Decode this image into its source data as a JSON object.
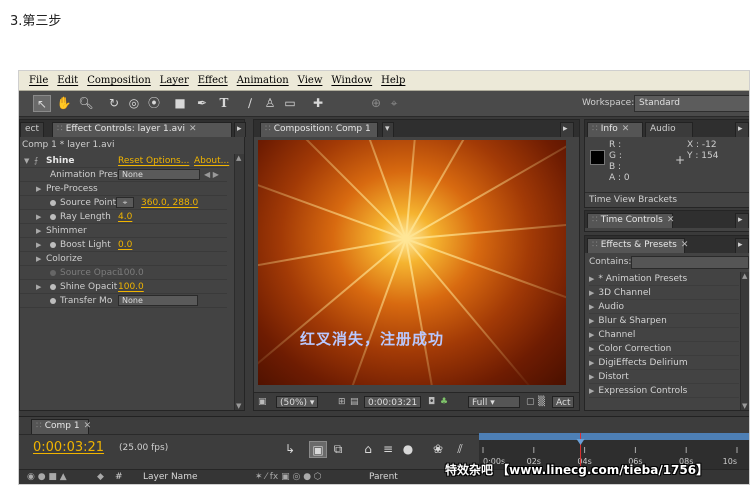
{
  "step_title": "3.第三步",
  "menu": [
    "File",
    "Edit",
    "Composition",
    "Layer",
    "Effect",
    "Animation",
    "View",
    "Window",
    "Help"
  ],
  "toolbar": {
    "tools": [
      "selection-tool-icon",
      "hand-tool-icon",
      "zoom-tool-icon",
      "rotate-tool-icon",
      "orbit-camera-icon",
      "pan-behind-icon",
      "rectangle-mask-icon",
      "pen-tool-icon",
      "type-tool-icon",
      "brush-tool-icon",
      "clone-stamp-icon",
      "eraser-icon",
      "puppet-pin-icon",
      "axis-icon"
    ],
    "workspace_label": "Workspace:",
    "workspace_value": "Standard"
  },
  "effect_controls": {
    "tab_left": "ect",
    "tab": "Effect Controls: layer 1.avi",
    "breadcrumb": "Comp 1 * layer 1.avi",
    "effect_name": "Shine",
    "reset_label": "Reset Options...",
    "about_label": "About...",
    "rows": [
      {
        "label": "Animation Prese",
        "value": "None",
        "kind": "select"
      },
      {
        "label": "Pre-Process",
        "kind": "group"
      },
      {
        "label": "Source Point",
        "value": "360.0, 288.0",
        "kind": "point"
      },
      {
        "label": "Ray Length",
        "value": "4.0",
        "kind": "value"
      },
      {
        "label": "Shimmer",
        "kind": "group"
      },
      {
        "label": "Boost Light",
        "value": "0.0",
        "kind": "value"
      },
      {
        "label": "Colorize",
        "kind": "group"
      },
      {
        "label": "Source Opaci",
        "value": "100.0",
        "kind": "disabled"
      },
      {
        "label": "Shine Opacit",
        "value": "100.0",
        "kind": "value"
      },
      {
        "label": "Transfer Mo",
        "value": "None",
        "kind": "select"
      }
    ]
  },
  "composition": {
    "tab": "Composition: Comp 1",
    "overlay_text": "红叉消失，注册成功",
    "zoom": "(50%)",
    "timecode": "0:00:03:21",
    "resolution": "Full",
    "extra": "Act"
  },
  "info": {
    "tab_info": "Info",
    "tab_audio": "Audio",
    "r_label": "R :",
    "g_label": "G :",
    "b_label": "B :",
    "a_label": "A : 0",
    "x_label": "X : -12",
    "y_label": "Y : 154",
    "bar_text": "Time View Brackets"
  },
  "time_controls": {
    "tab": "Time Controls"
  },
  "effects_presets": {
    "tab": "Effects & Presets",
    "contains_label": "Contains:",
    "items": [
      "* Animation Presets",
      "3D Channel",
      "Audio",
      "Blur & Sharpen",
      "Channel",
      "Color Correction",
      "DigiEffects Delirium",
      "Distort",
      "Expression Controls"
    ]
  },
  "timeline": {
    "tab": "Comp 1",
    "timecode": "0:00:03:21",
    "fps": "(25.00 fps)",
    "ticks": [
      "0:00s",
      "02s",
      "04s",
      "06s",
      "08s",
      "10s"
    ],
    "playhead_seconds": 3.84,
    "duration_seconds": 10,
    "columns": [
      "#",
      "Layer Name",
      "Parent"
    ]
  },
  "watermark": "特效杂吧 【www.linecg.com/tieba/1756】",
  "colors": {
    "accent": "#f0b400",
    "panel": "#434343",
    "overlay_text": "#b9c8ff"
  }
}
